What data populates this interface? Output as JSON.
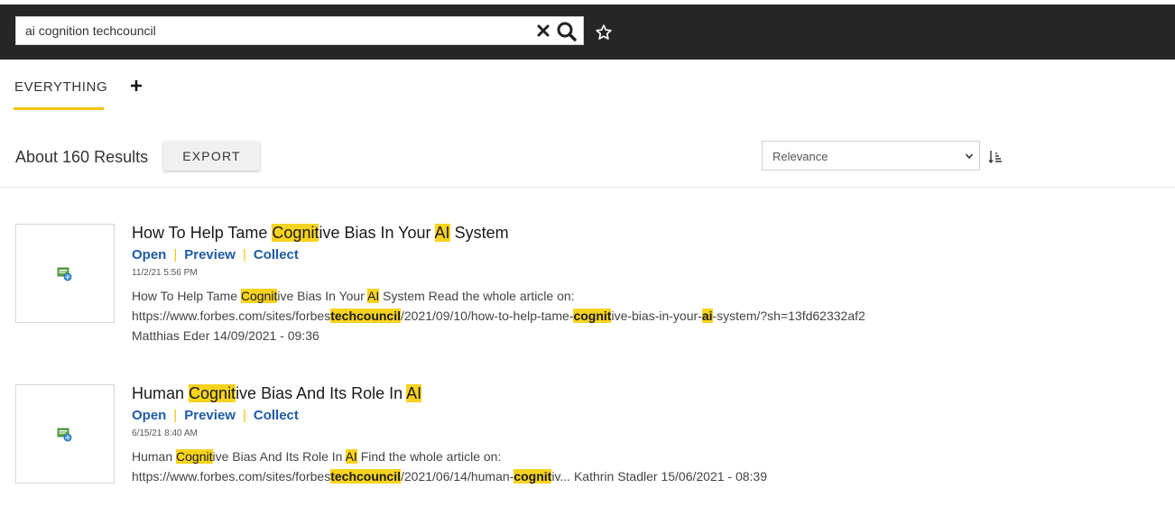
{
  "search": {
    "query": "ai cognition techcouncil",
    "clear_icon": "close-icon",
    "search_icon": "search-icon",
    "star_icon": "star-outline-icon"
  },
  "tabs": [
    {
      "label": "EVERYTHING",
      "active": true
    }
  ],
  "add_tab_icon": "plus-icon",
  "results_header": {
    "count_text": "About 160 Results",
    "export_label": "EXPORT",
    "sort_value": "Relevance",
    "sort_order_icon": "sort-descending-icon"
  },
  "colors": {
    "highlight": "#f7d31e",
    "link": "#1f5aa6",
    "topbar": "#262626",
    "accent": "#f1c40f"
  },
  "results": [
    {
      "title_parts": [
        "How To Help Tame ",
        "Cognit",
        "ive Bias In Your ",
        "AI",
        " System"
      ],
      "actions": [
        "Open",
        "Preview",
        "Collect"
      ],
      "date": "11/2/21 5:56 PM",
      "snippet_line1": [
        "How To Help Tame ",
        "Cognit",
        "ive Bias In Your ",
        "AI",
        " System Read the whole article on:"
      ],
      "snippet_line2": [
        "https://www.forbes.com/sites/forbes",
        "techcouncil",
        "/2021/09/10/how-to-help-tame-",
        "cognit",
        "ive-bias-in-your-",
        "ai",
        "-system/?sh=13fd62332af2"
      ],
      "snippet_line3": "Matthias Eder 14/09/2021 - 09:36",
      "thumb_icon": "html-file-icon"
    },
    {
      "title_parts": [
        "Human ",
        "Cognit",
        "ive Bias And Its Role In ",
        "AI"
      ],
      "actions": [
        "Open",
        "Preview",
        "Collect"
      ],
      "date": "6/15/21 8:40 AM",
      "snippet_line1": [
        "Human ",
        "Cognit",
        "ive Bias And Its Role In ",
        "AI",
        " Find the whole article on:"
      ],
      "snippet_line2": [
        "https://www.forbes.com/sites/forbes",
        "techcouncil",
        "/2021/06/14/human-",
        "cognit",
        "iv... Kathrin Stadler 15/06/2021 - 08:39"
      ],
      "thumb_icon": "html-file-icon"
    }
  ]
}
